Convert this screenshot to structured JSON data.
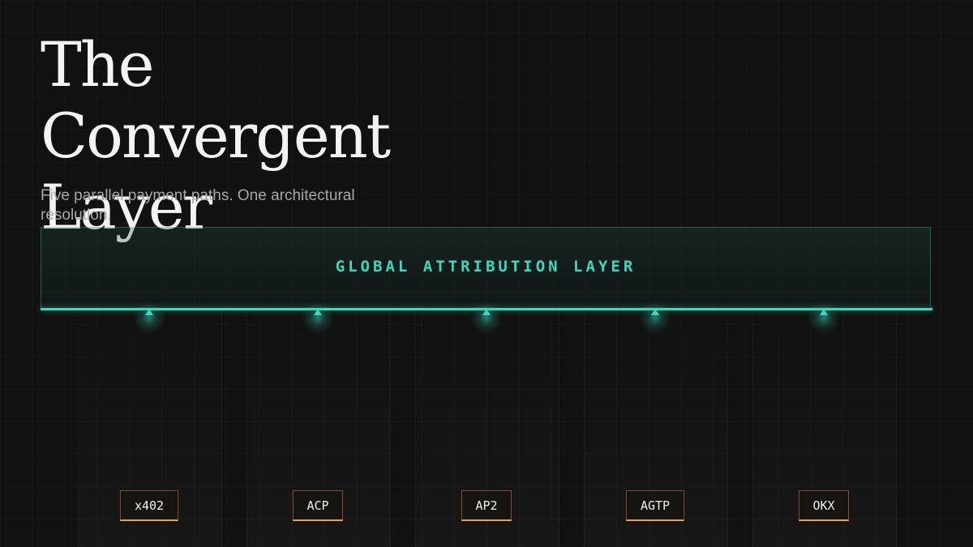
{
  "header": {
    "title_line1": "The Convergent",
    "title_line2": "Layer",
    "subtitle": "Five parallel payment paths. One architectural resolution."
  },
  "layer": {
    "label": "GLOBAL ATTRIBUTION LAYER"
  },
  "paths": [
    {
      "label": "x402"
    },
    {
      "label": "ACP"
    },
    {
      "label": "AP2"
    },
    {
      "label": "AGTP"
    },
    {
      "label": "OKX"
    }
  ],
  "colors": {
    "background": "#111111",
    "accent_teal": "#3ed8bd",
    "accent_amber": "#e8a440",
    "title_text": "#f4f4f4",
    "subtitle_text": "#a8a8a8"
  }
}
